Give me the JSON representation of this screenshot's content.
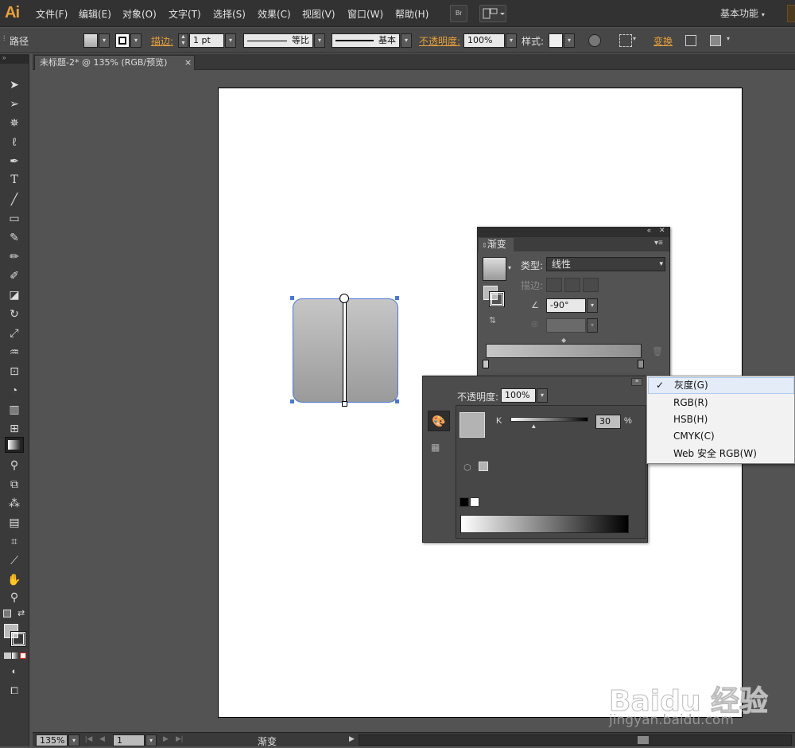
{
  "app": {
    "logo": "Ai"
  },
  "menubar": {
    "items": [
      "文件(F)",
      "编辑(E)",
      "对象(O)",
      "文字(T)",
      "选择(S)",
      "效果(C)",
      "视图(V)",
      "窗口(W)",
      "帮助(H)"
    ],
    "bridge_label": "Br",
    "workspace": "基本功能"
  },
  "controlbar": {
    "selection": "路径",
    "stroke_label": "描边:",
    "stroke_weight": "1 pt",
    "profile": "等比",
    "brush": "基本",
    "opacity_label": "不透明度:",
    "opacity_value": "100%",
    "style_label": "样式:",
    "transform_label": "变换"
  },
  "document_tab": {
    "title": "未标题-2* @ 135% (RGB/预览)",
    "close": "×"
  },
  "gradient_panel": {
    "title": "渐变",
    "type_label": "类型:",
    "type_value": "线性",
    "stroke_label": "描边:",
    "angle_value": "-90°"
  },
  "color_panel": {
    "opacity_label": "不透明度:",
    "opacity_value": "100%",
    "channel_label": "K",
    "channel_value": "30",
    "channel_unit": "%",
    "k_level": 0.3
  },
  "color_menu": {
    "items": [
      {
        "label": "灰度(G)",
        "checked": true
      },
      {
        "label": "RGB(R)",
        "checked": false
      },
      {
        "label": "HSB(H)",
        "checked": false
      },
      {
        "label": "CMYK(C)",
        "checked": false
      },
      {
        "label": "Web 安全 RGB(W)",
        "checked": false
      }
    ],
    "check_mark": "✓"
  },
  "statusbar": {
    "zoom": "135%",
    "artboard": "1",
    "tool": "渐变"
  },
  "watermark": {
    "line1": "Baidu 经验",
    "line2": "jingyan.baidu.com"
  },
  "colors": {
    "accent": "#e8a03a",
    "selection": "#4a76d6"
  }
}
